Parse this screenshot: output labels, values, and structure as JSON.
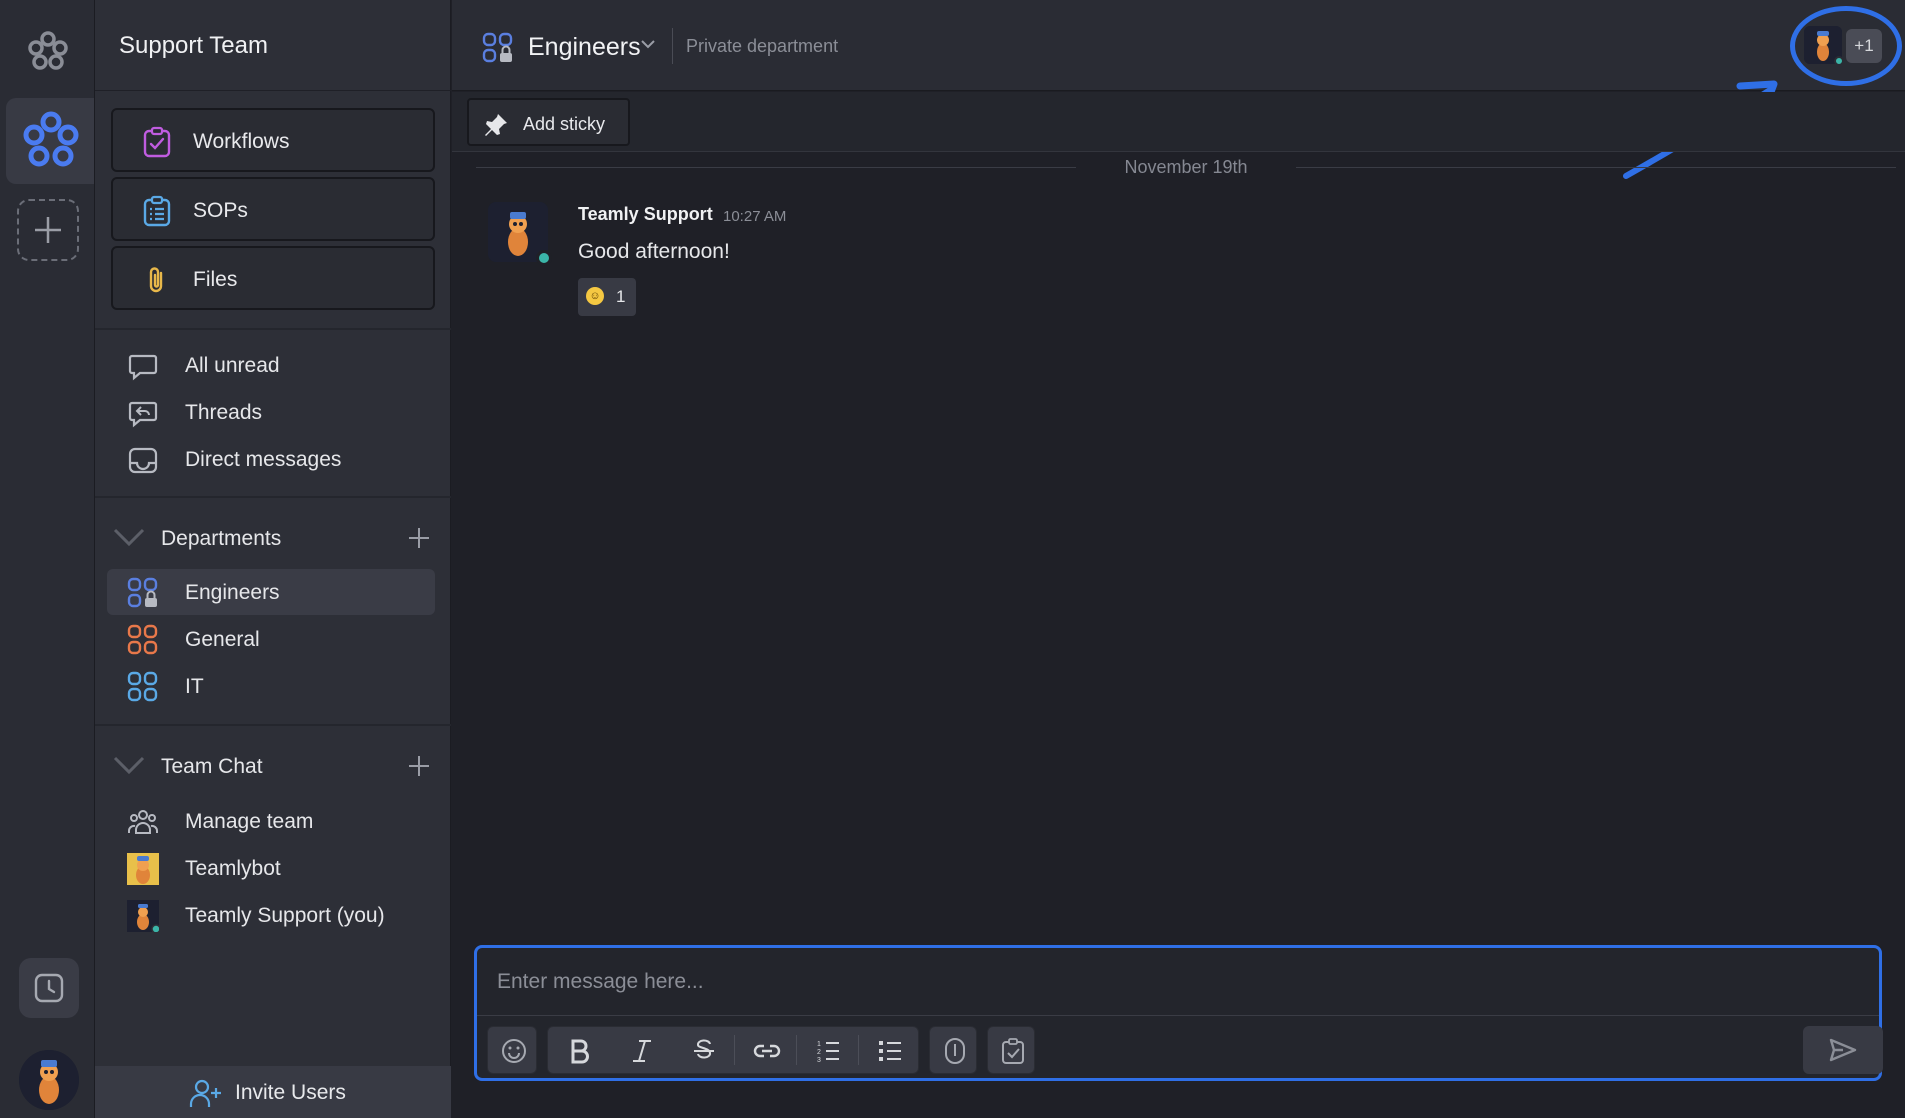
{
  "workspace": {
    "title": "Support Team"
  },
  "sidebar": {
    "cards": [
      {
        "label": "Workflows",
        "icon": "clipboard-check-icon"
      },
      {
        "label": "SOPs",
        "icon": "clipboard-list-icon"
      },
      {
        "label": "Files",
        "icon": "paperclip-icon"
      }
    ],
    "quick": [
      {
        "label": "All unread",
        "icon": "chat-bubble-icon"
      },
      {
        "label": "Threads",
        "icon": "thread-reply-icon"
      },
      {
        "label": "Direct messages",
        "icon": "inbox-icon"
      }
    ],
    "departments": {
      "label": "Departments",
      "items": [
        {
          "label": "Engineers",
          "icon": "private-department-icon",
          "active": true
        },
        {
          "label": "General",
          "icon": "department-icon"
        },
        {
          "label": "IT",
          "icon": "department-icon"
        }
      ]
    },
    "team_chat": {
      "label": "Team Chat",
      "items": [
        {
          "label": "Manage team",
          "icon": "team-icon"
        },
        {
          "label": "Teamlybot",
          "icon": "bot-avatar"
        },
        {
          "label": "Teamly Support (you)",
          "icon": "user-avatar"
        }
      ]
    },
    "invite_label": "Invite Users"
  },
  "channel": {
    "name": "Engineers",
    "subtitle": "Private department",
    "members_more": "+1"
  },
  "toolbar": {
    "add_sticky": "Add sticky"
  },
  "messages": {
    "date_divider": "November 19th",
    "items": [
      {
        "author": "Teamly Support",
        "time": "10:27 AM",
        "body": "Good afternoon!",
        "reaction_count": "1"
      }
    ]
  },
  "composer": {
    "placeholder": "Enter message here..."
  },
  "colors": {
    "accent": "#2f6fe6",
    "online": "#3bb5a8",
    "workflows_icon": "#c05ce0",
    "sops_icon": "#5aa9e6",
    "files_icon": "#e8b84a",
    "engineers_icon": "#5a7fe0",
    "general_icon": "#e8784a",
    "it_icon": "#5aa9e6"
  }
}
